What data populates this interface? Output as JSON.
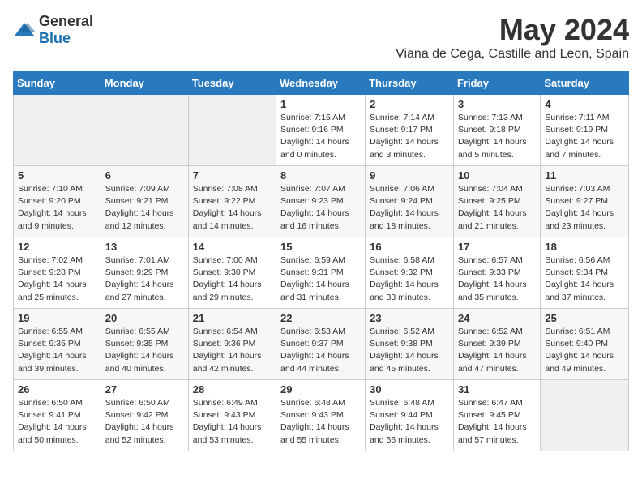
{
  "logo": {
    "general": "General",
    "blue": "Blue"
  },
  "title": "May 2024",
  "location": "Viana de Cega, Castille and Leon, Spain",
  "weekdays": [
    "Sunday",
    "Monday",
    "Tuesday",
    "Wednesday",
    "Thursday",
    "Friday",
    "Saturday"
  ],
  "weeks": [
    [
      {
        "day": "",
        "sunrise": "",
        "sunset": "",
        "daylight": ""
      },
      {
        "day": "",
        "sunrise": "",
        "sunset": "",
        "daylight": ""
      },
      {
        "day": "",
        "sunrise": "",
        "sunset": "",
        "daylight": ""
      },
      {
        "day": "1",
        "sunrise": "Sunrise: 7:15 AM",
        "sunset": "Sunset: 9:16 PM",
        "daylight": "Daylight: 14 hours and 0 minutes."
      },
      {
        "day": "2",
        "sunrise": "Sunrise: 7:14 AM",
        "sunset": "Sunset: 9:17 PM",
        "daylight": "Daylight: 14 hours and 3 minutes."
      },
      {
        "day": "3",
        "sunrise": "Sunrise: 7:13 AM",
        "sunset": "Sunset: 9:18 PM",
        "daylight": "Daylight: 14 hours and 5 minutes."
      },
      {
        "day": "4",
        "sunrise": "Sunrise: 7:11 AM",
        "sunset": "Sunset: 9:19 PM",
        "daylight": "Daylight: 14 hours and 7 minutes."
      }
    ],
    [
      {
        "day": "5",
        "sunrise": "Sunrise: 7:10 AM",
        "sunset": "Sunset: 9:20 PM",
        "daylight": "Daylight: 14 hours and 9 minutes."
      },
      {
        "day": "6",
        "sunrise": "Sunrise: 7:09 AM",
        "sunset": "Sunset: 9:21 PM",
        "daylight": "Daylight: 14 hours and 12 minutes."
      },
      {
        "day": "7",
        "sunrise": "Sunrise: 7:08 AM",
        "sunset": "Sunset: 9:22 PM",
        "daylight": "Daylight: 14 hours and 14 minutes."
      },
      {
        "day": "8",
        "sunrise": "Sunrise: 7:07 AM",
        "sunset": "Sunset: 9:23 PM",
        "daylight": "Daylight: 14 hours and 16 minutes."
      },
      {
        "day": "9",
        "sunrise": "Sunrise: 7:06 AM",
        "sunset": "Sunset: 9:24 PM",
        "daylight": "Daylight: 14 hours and 18 minutes."
      },
      {
        "day": "10",
        "sunrise": "Sunrise: 7:04 AM",
        "sunset": "Sunset: 9:25 PM",
        "daylight": "Daylight: 14 hours and 21 minutes."
      },
      {
        "day": "11",
        "sunrise": "Sunrise: 7:03 AM",
        "sunset": "Sunset: 9:27 PM",
        "daylight": "Daylight: 14 hours and 23 minutes."
      }
    ],
    [
      {
        "day": "12",
        "sunrise": "Sunrise: 7:02 AM",
        "sunset": "Sunset: 9:28 PM",
        "daylight": "Daylight: 14 hours and 25 minutes."
      },
      {
        "day": "13",
        "sunrise": "Sunrise: 7:01 AM",
        "sunset": "Sunset: 9:29 PM",
        "daylight": "Daylight: 14 hours and 27 minutes."
      },
      {
        "day": "14",
        "sunrise": "Sunrise: 7:00 AM",
        "sunset": "Sunset: 9:30 PM",
        "daylight": "Daylight: 14 hours and 29 minutes."
      },
      {
        "day": "15",
        "sunrise": "Sunrise: 6:59 AM",
        "sunset": "Sunset: 9:31 PM",
        "daylight": "Daylight: 14 hours and 31 minutes."
      },
      {
        "day": "16",
        "sunrise": "Sunrise: 6:58 AM",
        "sunset": "Sunset: 9:32 PM",
        "daylight": "Daylight: 14 hours and 33 minutes."
      },
      {
        "day": "17",
        "sunrise": "Sunrise: 6:57 AM",
        "sunset": "Sunset: 9:33 PM",
        "daylight": "Daylight: 14 hours and 35 minutes."
      },
      {
        "day": "18",
        "sunrise": "Sunrise: 6:56 AM",
        "sunset": "Sunset: 9:34 PM",
        "daylight": "Daylight: 14 hours and 37 minutes."
      }
    ],
    [
      {
        "day": "19",
        "sunrise": "Sunrise: 6:55 AM",
        "sunset": "Sunset: 9:35 PM",
        "daylight": "Daylight: 14 hours and 39 minutes."
      },
      {
        "day": "20",
        "sunrise": "Sunrise: 6:55 AM",
        "sunset": "Sunset: 9:35 PM",
        "daylight": "Daylight: 14 hours and 40 minutes."
      },
      {
        "day": "21",
        "sunrise": "Sunrise: 6:54 AM",
        "sunset": "Sunset: 9:36 PM",
        "daylight": "Daylight: 14 hours and 42 minutes."
      },
      {
        "day": "22",
        "sunrise": "Sunrise: 6:53 AM",
        "sunset": "Sunset: 9:37 PM",
        "daylight": "Daylight: 14 hours and 44 minutes."
      },
      {
        "day": "23",
        "sunrise": "Sunrise: 6:52 AM",
        "sunset": "Sunset: 9:38 PM",
        "daylight": "Daylight: 14 hours and 45 minutes."
      },
      {
        "day": "24",
        "sunrise": "Sunrise: 6:52 AM",
        "sunset": "Sunset: 9:39 PM",
        "daylight": "Daylight: 14 hours and 47 minutes."
      },
      {
        "day": "25",
        "sunrise": "Sunrise: 6:51 AM",
        "sunset": "Sunset: 9:40 PM",
        "daylight": "Daylight: 14 hours and 49 minutes."
      }
    ],
    [
      {
        "day": "26",
        "sunrise": "Sunrise: 6:50 AM",
        "sunset": "Sunset: 9:41 PM",
        "daylight": "Daylight: 14 hours and 50 minutes."
      },
      {
        "day": "27",
        "sunrise": "Sunrise: 6:50 AM",
        "sunset": "Sunset: 9:42 PM",
        "daylight": "Daylight: 14 hours and 52 minutes."
      },
      {
        "day": "28",
        "sunrise": "Sunrise: 6:49 AM",
        "sunset": "Sunset: 9:43 PM",
        "daylight": "Daylight: 14 hours and 53 minutes."
      },
      {
        "day": "29",
        "sunrise": "Sunrise: 6:48 AM",
        "sunset": "Sunset: 9:43 PM",
        "daylight": "Daylight: 14 hours and 55 minutes."
      },
      {
        "day": "30",
        "sunrise": "Sunrise: 6:48 AM",
        "sunset": "Sunset: 9:44 PM",
        "daylight": "Daylight: 14 hours and 56 minutes."
      },
      {
        "day": "31",
        "sunrise": "Sunrise: 6:47 AM",
        "sunset": "Sunset: 9:45 PM",
        "daylight": "Daylight: 14 hours and 57 minutes."
      },
      {
        "day": "",
        "sunrise": "",
        "sunset": "",
        "daylight": ""
      }
    ]
  ]
}
